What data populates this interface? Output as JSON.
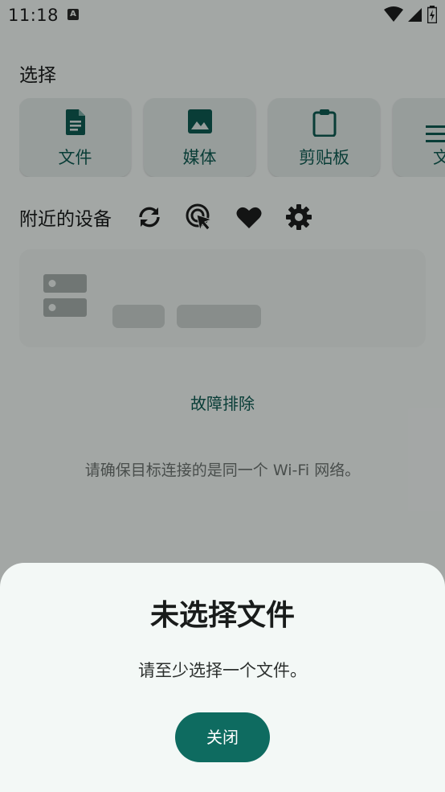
{
  "status_bar": {
    "time": "11:18",
    "notification_letter": "A",
    "icons": [
      "wifi-icon",
      "cell-signal-icon",
      "battery-charging-icon"
    ]
  },
  "send": {
    "title": "选择",
    "pickers": [
      {
        "label": "文件",
        "icon": "file-icon"
      },
      {
        "label": "媒体",
        "icon": "image-icon"
      },
      {
        "label": "剪贴板",
        "icon": "clipboard-icon"
      },
      {
        "label": "文",
        "icon": "text-icon"
      }
    ]
  },
  "nearby": {
    "title": "附近的设备",
    "actions": [
      "refresh-icon",
      "manual-send-icon",
      "favorites-icon",
      "settings-icon"
    ]
  },
  "troubleshoot_label": "故障排除",
  "hint": "请确保目标连接的是同一个 Wi-Fi 网络。",
  "dialog": {
    "title": "未选择文件",
    "message": "请至少选择一个文件。",
    "close_label": "关闭"
  },
  "colors": {
    "accent": "#0e5c53",
    "button": "#0e6b60",
    "background": "#f4f9f7"
  }
}
